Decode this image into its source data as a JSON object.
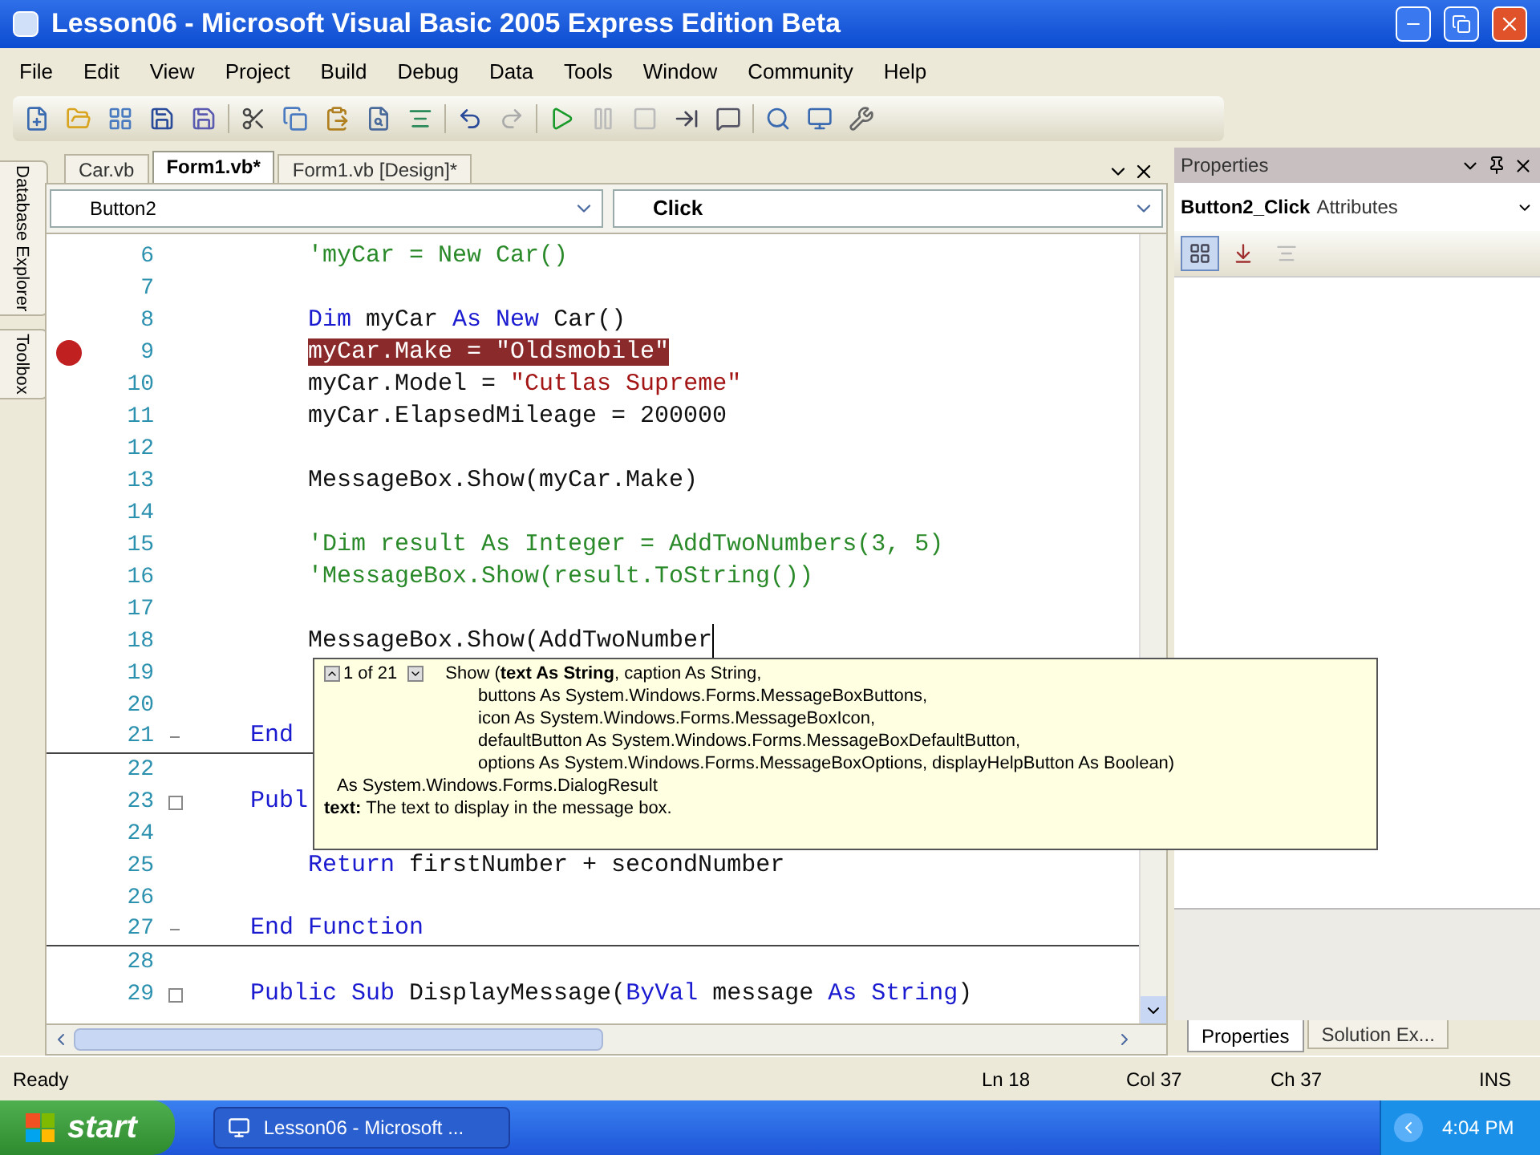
{
  "window": {
    "title": "Lesson06 - Microsoft Visual Basic 2005 Express Edition Beta"
  },
  "menu": [
    "File",
    "Edit",
    "View",
    "Project",
    "Build",
    "Debug",
    "Data",
    "Tools",
    "Window",
    "Community",
    "Help"
  ],
  "left_dock": [
    "Database Explorer",
    "Toolbox"
  ],
  "editor": {
    "tabs": [
      {
        "label": "Car.vb",
        "selected": false
      },
      {
        "label": "Form1.vb*",
        "selected": true
      },
      {
        "label": "Form1.vb [Design]*",
        "selected": false
      }
    ],
    "object_dropdown": "Button2",
    "event_dropdown": "Click",
    "lines": [
      {
        "number": "6",
        "tokens": [
          {
            "kind": "comment",
            "text": "        'myCar = New Car()"
          }
        ]
      },
      {
        "number": "7"
      },
      {
        "number": "8",
        "tokens": [
          {
            "kind": "keyword",
            "text": "        Dim"
          },
          {
            "kind": "plain",
            "text": " myCar "
          },
          {
            "kind": "keyword",
            "text": "As New"
          },
          {
            "kind": "plain",
            "text": " Car()"
          }
        ]
      },
      {
        "number": "9",
        "breakpoint": true,
        "tokens": [
          {
            "kind": "highlight",
            "text": "        myCar.Make = \"Oldsmobile\""
          }
        ]
      },
      {
        "number": "10",
        "tokens": [
          {
            "kind": "plain",
            "text": "        myCar.Model = "
          },
          {
            "kind": "string",
            "text": "\"Cutlas Supreme\""
          }
        ]
      },
      {
        "number": "11",
        "tokens": [
          {
            "kind": "plain",
            "text": "        myCar.ElapsedMileage = 200000"
          }
        ]
      },
      {
        "number": "12"
      },
      {
        "number": "13",
        "tokens": [
          {
            "kind": "plain",
            "text": "        MessageBox.Show(myCar.Make)"
          }
        ]
      },
      {
        "number": "14"
      },
      {
        "number": "15",
        "tokens": [
          {
            "kind": "comment",
            "text": "        'Dim result As Integer = AddTwoNumbers(3, 5)"
          }
        ]
      },
      {
        "number": "16",
        "tokens": [
          {
            "kind": "comment",
            "text": "        'MessageBox.Show(result.ToString())"
          }
        ]
      },
      {
        "number": "17"
      },
      {
        "number": "18",
        "caret": true,
        "tokens": [
          {
            "kind": "plain",
            "text": "        MessageBox.Show(AddTwoNumber"
          }
        ]
      },
      {
        "number": "19"
      },
      {
        "number": "20"
      },
      {
        "number": "21",
        "outline_end": true,
        "rule_below": true,
        "tokens": [
          {
            "kind": "keyword",
            "text": "    End"
          }
        ]
      },
      {
        "number": "22"
      },
      {
        "number": "23",
        "outline_start": true,
        "tokens": [
          {
            "kind": "keyword",
            "text": "    Publ"
          }
        ]
      },
      {
        "number": "24"
      },
      {
        "number": "25",
        "tokens": [
          {
            "kind": "keyword",
            "text": "        Return"
          },
          {
            "kind": "plain",
            "text": " firstNumber + secondNumber"
          }
        ]
      },
      {
        "number": "26"
      },
      {
        "number": "27",
        "outline_end": true,
        "rule_below": true,
        "tokens": [
          {
            "kind": "keyword",
            "text": "    End Function"
          }
        ]
      },
      {
        "number": "28"
      },
      {
        "number": "29",
        "outline_start": true,
        "tokens": [
          {
            "kind": "keyword",
            "text": "    Public Sub"
          },
          {
            "kind": "plain",
            "text": " DisplayMessage("
          },
          {
            "kind": "keyword",
            "text": "ByVal"
          },
          {
            "kind": "plain",
            "text": " message "
          },
          {
            "kind": "keyword",
            "text": "As String"
          },
          {
            "kind": "plain",
            "text": ")"
          }
        ]
      }
    ]
  },
  "tooltip": {
    "counter": "1 of 21",
    "signature": [
      "Show (**text As String**, caption As String,",
      "buttons As System.Windows.Forms.MessageBoxButtons,",
      "icon As System.Windows.Forms.MessageBoxIcon,",
      "defaultButton As System.Windows.Forms.MessageBoxDefaultButton,",
      "options As System.Windows.Forms.MessageBoxOptions, displayHelpButton As Boolean)"
    ],
    "returns": "As System.Windows.Forms.DialogResult",
    "description": "**text:** The text to display in the message box."
  },
  "properties": {
    "title": "Properties",
    "object": "Button2_Click",
    "object_type": "Attributes",
    "toolbar": [
      {
        "kind": "categorized",
        "selected": true
      },
      {
        "kind": "alphabetical",
        "selected": false
      },
      {
        "kind": "pages",
        "selected": false
      }
    ],
    "tabs": [
      {
        "label": "Properties",
        "selected": true
      },
      {
        "label": "Solution Ex...",
        "selected": false
      }
    ]
  },
  "status_bar": {
    "message": "Ready",
    "line": "Ln 18",
    "column": "Col 37",
    "char": "Ch 37",
    "mode": "INS"
  },
  "taskbar": {
    "start": "start",
    "tasks": [
      "Lesson06 - Microsoft ..."
    ],
    "clock": "4:04 PM"
  }
}
